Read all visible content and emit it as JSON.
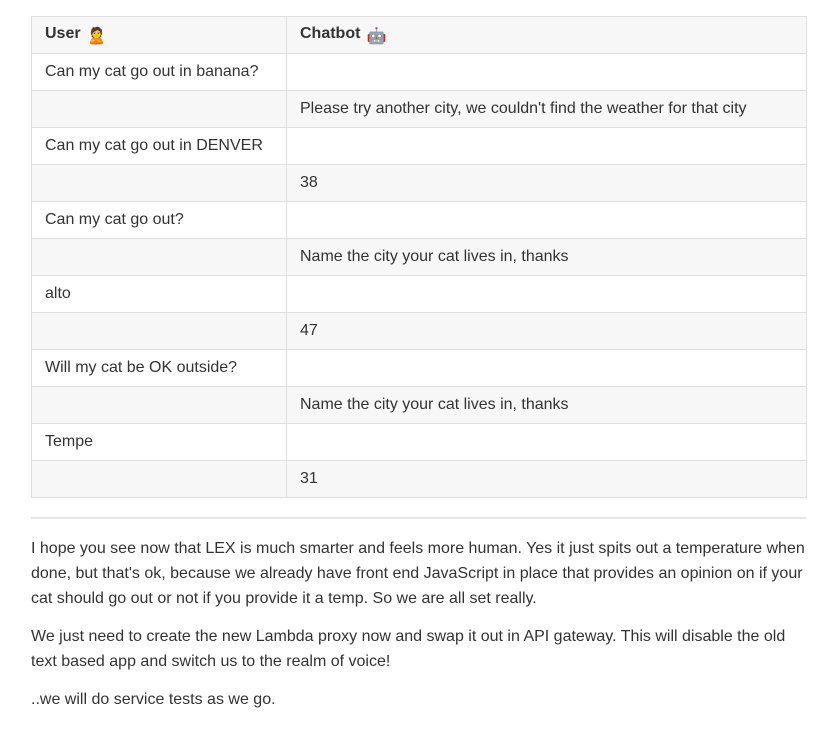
{
  "table": {
    "headers": {
      "user": "User",
      "user_emoji": "🙎",
      "chatbot": "Chatbot",
      "chatbot_emoji": "🤖"
    },
    "rows": [
      {
        "user": "Can my cat go out in banana?",
        "bot": ""
      },
      {
        "user": "",
        "bot": "Please try another city, we couldn't find the weather for that city"
      },
      {
        "user": "Can my cat go out in DENVER",
        "bot": ""
      },
      {
        "user": "",
        "bot": "38"
      },
      {
        "user": "Can my cat go out?",
        "bot": ""
      },
      {
        "user": "",
        "bot": "Name the city your cat lives in, thanks"
      },
      {
        "user": "alto",
        "bot": ""
      },
      {
        "user": "",
        "bot": "47"
      },
      {
        "user": "Will my cat be OK outside?",
        "bot": ""
      },
      {
        "user": "",
        "bot": "Name the city your cat lives in, thanks"
      },
      {
        "user": "Tempe",
        "bot": ""
      },
      {
        "user": "",
        "bot": "31"
      }
    ]
  },
  "paragraphs": {
    "p1": "I hope you see now that LEX is much smarter and feels more human. Yes it just spits out a temperature when done, but that's ok, because we already have front end JavaScript in place that provides an opinion on if your cat should go out or not if you provide it a temp. So we are all set really.",
    "p2": "We just need to create the new Lambda proxy now and swap it out in API gateway. This will disable the old text based app and switch us to the realm of voice!",
    "p3": "..we will do service tests as we go."
  }
}
